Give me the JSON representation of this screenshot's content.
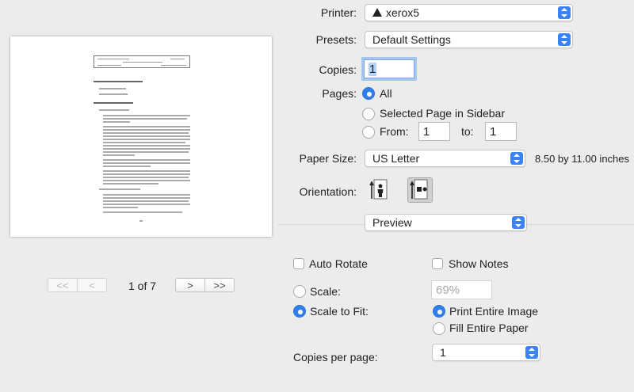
{
  "pager": {
    "first_label": "<<",
    "prev_label": "<",
    "page_status": "1 of 7",
    "next_label": ">",
    "last_label": ">>"
  },
  "printer": {
    "label": "Printer:",
    "value": "xerox5",
    "status_icon": "warning-triangle-icon"
  },
  "presets": {
    "label": "Presets:",
    "value": "Default Settings"
  },
  "copies": {
    "label": "Copies:",
    "value": "1"
  },
  "pages": {
    "label": "Pages:",
    "all_label": "All",
    "selected_label": "Selected Page in Sidebar",
    "from_label": "From:",
    "from_value": "1",
    "to_label": "to:",
    "to_value": "1",
    "selected_option": "All"
  },
  "paper_size": {
    "label": "Paper Size:",
    "value": "US Letter",
    "dimensions": "8.50 by 11.00 inches"
  },
  "orientation": {
    "label": "Orientation:",
    "selected": "landscape"
  },
  "app_section": {
    "value": "Preview"
  },
  "options": {
    "auto_rotate_label": "Auto Rotate",
    "show_notes_label": "Show Notes",
    "scale_label": "Scale:",
    "scale_value": "69%",
    "scale_to_fit_label": "Scale to Fit:",
    "print_entire_image_label": "Print Entire Image",
    "fill_entire_paper_label": "Fill Entire Paper",
    "copies_per_page_label": "Copies per page:",
    "copies_per_page_value": "1"
  },
  "colors": {
    "accent": "#2f7ff0",
    "background": "#ececec"
  }
}
